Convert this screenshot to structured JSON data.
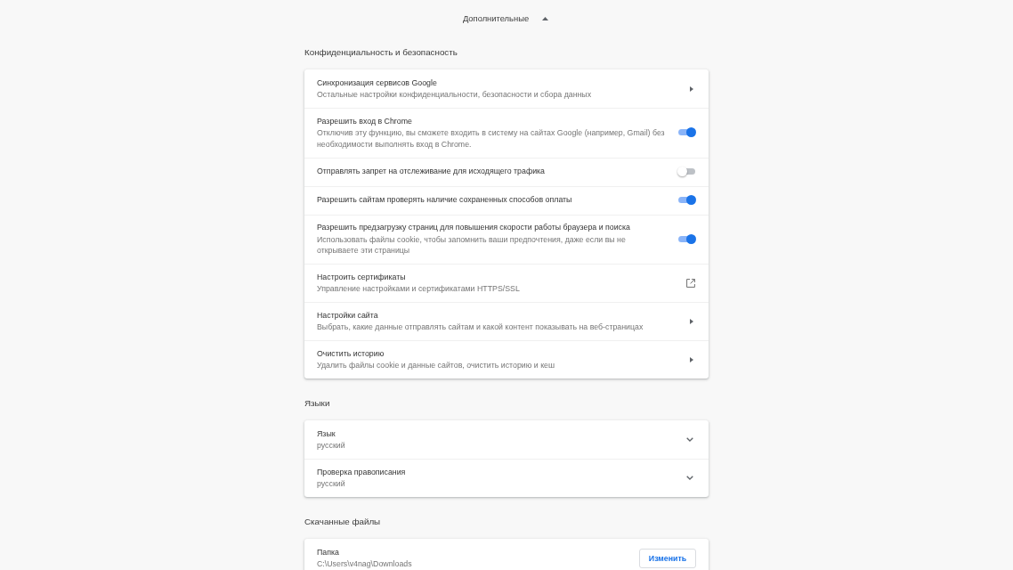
{
  "advanced_toggle": {
    "label": "Дополнительные",
    "expanded": true
  },
  "sections": [
    {
      "title": "Конфиденциальность и безопасность",
      "rows": [
        {
          "kind": "link",
          "title": "Синхронизация сервисов Google",
          "subtitle": "Остальные настройки конфиденциальности, безопасности и сбора данных"
        },
        {
          "kind": "toggle",
          "title": "Разрешить вход в Chrome",
          "subtitle": "Отключив эту функцию, вы сможете входить в систему на сайтах Google (например, Gmail) без необходимости выполнять вход в Chrome.",
          "on": true
        },
        {
          "kind": "toggle",
          "title": "Отправлять запрет на отслеживание для исходящего трафика",
          "on": false
        },
        {
          "kind": "toggle",
          "title": "Разрешить сайтам проверять наличие сохраненных способов оплаты",
          "on": true
        },
        {
          "kind": "toggle",
          "title": "Разрешить предзагрузку страниц для повышения скорости работы браузера и поиска",
          "subtitle": "Использовать файлы cookie, чтобы запомнить ваши предпочтения, даже если вы не открываете эти страницы",
          "on": true
        },
        {
          "kind": "external",
          "title": "Настроить сертификаты",
          "subtitle": "Управление настройками и сертификатами HTTPS/SSL"
        },
        {
          "kind": "link",
          "title": "Настройки сайта",
          "subtitle": "Выбрать, какие данные отправлять сайтам и какой контент показывать на веб-страницах"
        },
        {
          "kind": "link",
          "title": "Очистить историю",
          "subtitle": "Удалить файлы cookie и данные сайтов, очистить историю и кеш"
        }
      ]
    },
    {
      "title": "Языки",
      "rows": [
        {
          "kind": "dropdown",
          "title": "Язык",
          "subtitle": "русский"
        },
        {
          "kind": "dropdown",
          "title": "Проверка правописания",
          "subtitle": "русский"
        }
      ]
    },
    {
      "title": "Скачанные файлы",
      "rows": [
        {
          "kind": "button",
          "title": "Папка",
          "subtitle": "C:\\Users\\v4nag\\Downloads",
          "button": "Изменить"
        }
      ]
    }
  ]
}
